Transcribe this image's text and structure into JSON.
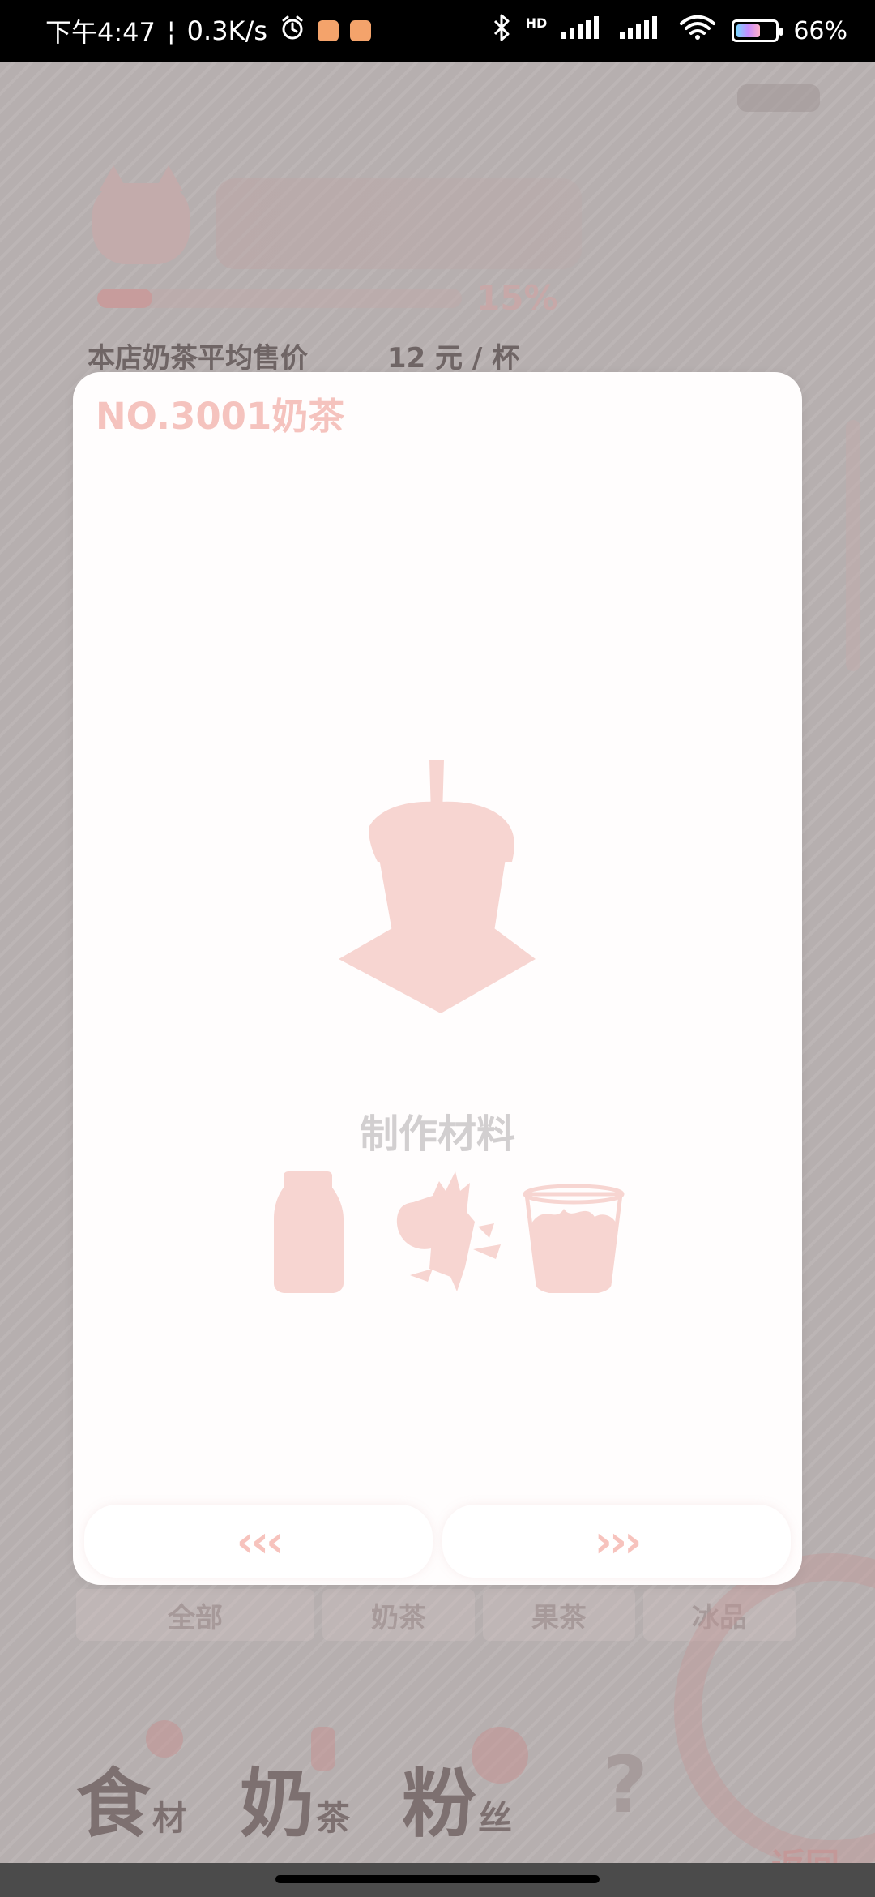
{
  "statusbar": {
    "time": "下午4:47",
    "network_speed": "0.3K/s",
    "signal_hd": "HD",
    "battery_percent": "66%",
    "battery_level": 0.66
  },
  "background": {
    "progress_percent": "15%",
    "progress_value": 0.15,
    "avg_price_label": "本店奶茶平均售价",
    "avg_price_value": "12 元 / 杯",
    "tabs": [
      "全部",
      "奶茶",
      "果茶",
      "冰品"
    ],
    "nav": {
      "ingredients_big": "食",
      "ingredients_small": "材",
      "milk_tea_big": "奶",
      "milk_tea_small": "茶",
      "fans_big": "粉",
      "fans_small": "丝",
      "unknown": "?"
    },
    "back_label": "返回"
  },
  "modal": {
    "title": "NO.3001奶茶",
    "materials_title": "制作材料",
    "prev_label": "‹‹‹",
    "next_label": "›››"
  },
  "colors": {
    "modal_accent": "#f7c3bd",
    "modal_muted_text": "#d2cfd0",
    "overlay": "#b6afaf"
  },
  "icons": {
    "drink": "bubble-tea-silhouette-icon",
    "material_1": "milk-bottle-icon",
    "material_2": "tea-leaves-icon",
    "material_3": "ice-cup-icon"
  }
}
